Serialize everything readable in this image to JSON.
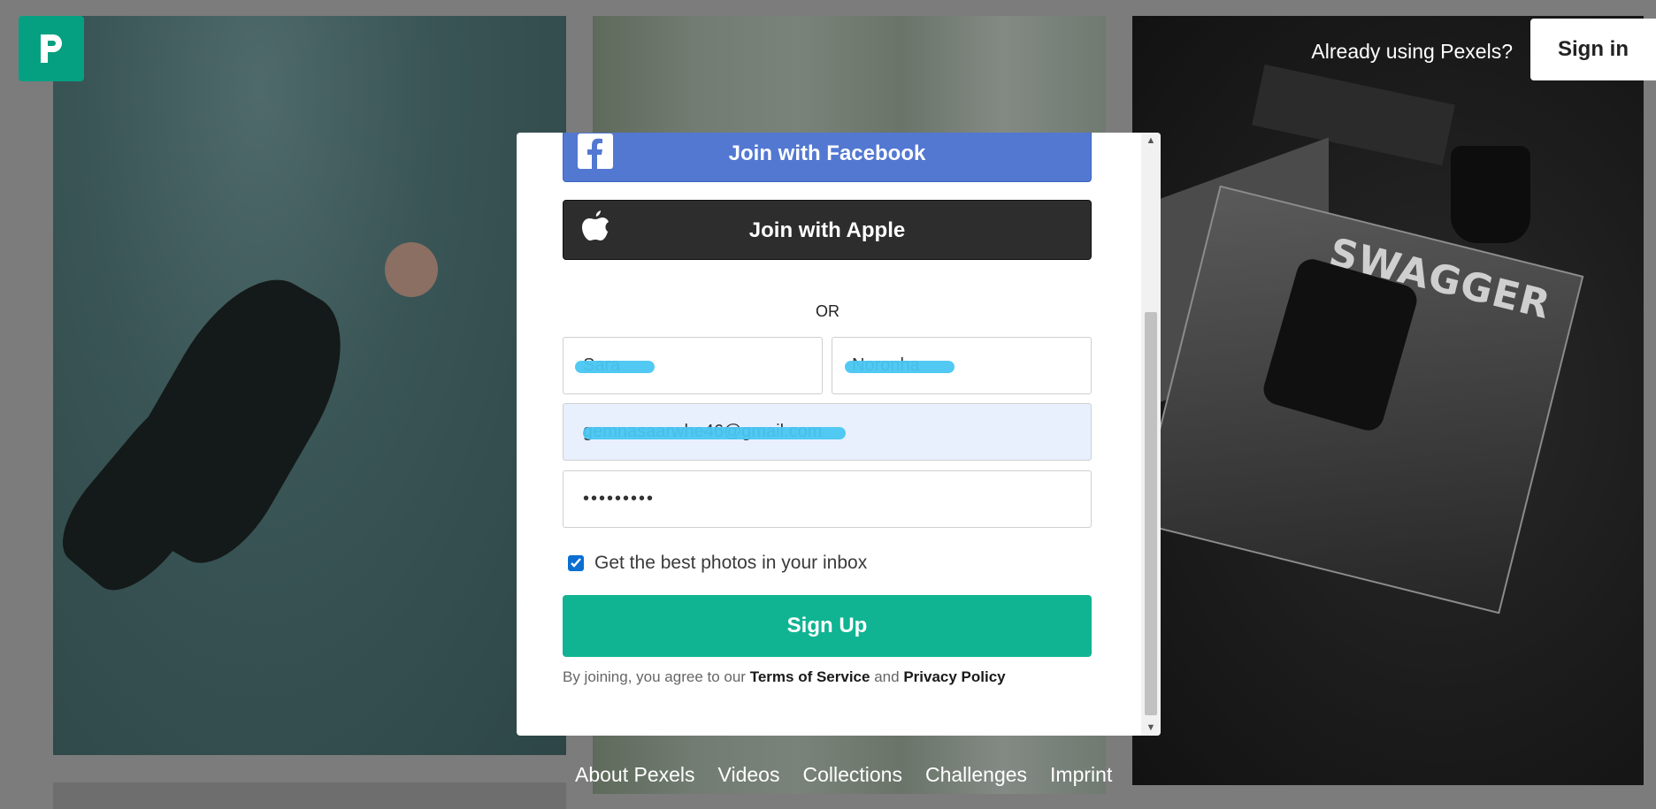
{
  "header": {
    "already_text": "Already using Pexels?",
    "signin_label": "Sign in"
  },
  "modal": {
    "facebook_label": "Join with Facebook",
    "apple_label": "Join with Apple",
    "or_text": "OR",
    "first_name_value": "Sara",
    "last_name_value": "Noronha",
    "email_value": "gemnasaarwhe46@gmail.com",
    "password_value": "•••••••••",
    "newsletter_label": "Get the best photos in your inbox",
    "newsletter_checked": true,
    "signup_label": "Sign Up",
    "terms_prefix": "By joining, you agree to our",
    "terms_link": "Terms of Service",
    "terms_and": "and",
    "privacy_link": "Privacy Policy"
  },
  "background": {
    "magazine_title": "SWAGGER"
  },
  "footer": {
    "links": [
      "About Pexels",
      "Videos",
      "Collections",
      "Challenges",
      "Imprint"
    ]
  },
  "colors": {
    "brand_green": "#05a081",
    "signup_green": "#10b492",
    "facebook_blue": "#5278d2",
    "apple_dark": "#2d2d2d",
    "checkbox_blue": "#0a6fd1"
  }
}
